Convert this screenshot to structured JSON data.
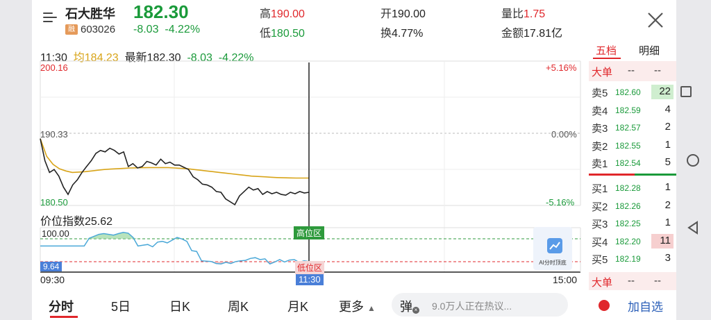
{
  "stock": {
    "name": "石大胜华",
    "code": "603026",
    "rong_badge": "融",
    "price": "182.30",
    "change": "-8.03",
    "change_pct": "-4.22%"
  },
  "header_stats": {
    "high_label": "高",
    "high_value": "190.00",
    "low_label": "低",
    "low_value": "180.50",
    "open_label": "开",
    "open_value": "190.00",
    "turnover_label": "换",
    "turnover_value": "4.77%",
    "volratio_label": "量比",
    "volratio_value": "1.75",
    "amount_label": "金额",
    "amount_value": "17.81亿"
  },
  "chart_info": {
    "time": "11:30",
    "avg_label": "均",
    "avg_value": "184.23",
    "latest_label": "最新",
    "latest_value": "182.30",
    "change": "-8.03",
    "change_pct": "-4.22%"
  },
  "chart_data": {
    "type": "line",
    "y_max": "200.16",
    "y_mid": "190.33",
    "y_min": "180.50",
    "pct_top": "+5.16%",
    "pct_mid": "0.00%",
    "pct_bottom": "-5.16%",
    "ylim": [
      180.5,
      200.16
    ],
    "x_start": "09:30",
    "x_cursor": "11:30",
    "x_end": "15:00",
    "series": [
      {
        "values": [
          189.6,
          186.6,
          185.0,
          185.4,
          184.5,
          183.0,
          182.0,
          183.3,
          184.0,
          185.0,
          185.8,
          186.6,
          187.6,
          188.0,
          187.8,
          188.3,
          188.0,
          187.5,
          187.8,
          185.8,
          186.2,
          185.6,
          185.8,
          186.5,
          186.3,
          186.0,
          186.8,
          186.2,
          186.4,
          186.0,
          186.0,
          185.7,
          185.4,
          184.4,
          184.0,
          183.4,
          183.3,
          183.0,
          182.4,
          182.3,
          181.4,
          181.0,
          180.6,
          181.8,
          182.4,
          183.0,
          182.6,
          182.8,
          182.0,
          182.4,
          182.1,
          182.3,
          182.0,
          181.9,
          182.3,
          182.1,
          182.4,
          182.2,
          182.3
        ]
      },
      {
        "values": [
          189.6,
          187.2,
          186.1,
          185.5,
          185.2,
          185.0,
          185.05,
          185.1,
          185.2,
          185.3,
          185.4,
          185.45,
          185.5,
          185.55,
          185.6,
          185.62,
          185.64,
          185.66,
          185.66,
          185.66,
          185.66,
          185.6,
          185.55,
          185.5,
          185.4,
          185.3,
          185.2,
          185.1,
          185.0,
          184.9,
          184.8,
          184.7,
          184.6,
          184.5,
          184.45,
          184.4,
          184.35,
          184.3,
          184.27,
          184.25,
          184.23,
          184.23,
          184.23
        ]
      }
    ]
  },
  "indicator": {
    "title": "价位指数25.62",
    "top_value": "100.00",
    "current_value": "9.64",
    "high_zone": "高位区",
    "low_zone": "低位区",
    "values": [
      60,
      60,
      60,
      60,
      60,
      60,
      60,
      60,
      60,
      60,
      80,
      85,
      90,
      92,
      90,
      88,
      92,
      95,
      93,
      82,
      60,
      62,
      64,
      58,
      70,
      72,
      68,
      75,
      82,
      78,
      72,
      48,
      46,
      22,
      21,
      20,
      15,
      14,
      18,
      15,
      20,
      22,
      23,
      28,
      30,
      25,
      27,
      14,
      19,
      25,
      19,
      24,
      25,
      18,
      22,
      20
    ]
  },
  "ai_widget": {
    "label": "AI分时顶底"
  },
  "order_book": {
    "tab_active": "五档",
    "tab_other": "明细",
    "big_label": "大单",
    "big_dash1": "--",
    "big_dash2": "--",
    "asks": [
      {
        "label": "卖5",
        "price": "182.60",
        "vol": "22",
        "bar": 1.0
      },
      {
        "label": "卖4",
        "price": "182.59",
        "vol": "4",
        "bar": 0
      },
      {
        "label": "卖3",
        "price": "182.57",
        "vol": "2",
        "bar": 0
      },
      {
        "label": "卖2",
        "price": "182.55",
        "vol": "1",
        "bar": 0
      },
      {
        "label": "卖1",
        "price": "182.54",
        "vol": "5",
        "bar": 0
      }
    ],
    "bids": [
      {
        "label": "买1",
        "price": "182.28",
        "vol": "1",
        "bar": 0
      },
      {
        "label": "买2",
        "price": "182.26",
        "vol": "2",
        "bar": 0
      },
      {
        "label": "买3",
        "price": "182.25",
        "vol": "1",
        "bar": 0
      },
      {
        "label": "买4",
        "price": "182.20",
        "vol": "11",
        "bar": 1.0
      },
      {
        "label": "买5",
        "price": "182.19",
        "vol": "3",
        "bar": 0
      }
    ],
    "big_label2": "大单",
    "big_dash3": "--",
    "big_dash4": "--"
  },
  "bottom_nav": {
    "tabs": [
      "分时",
      "5日",
      "日K",
      "周K",
      "月K"
    ],
    "more": "更多",
    "danmu": "弹",
    "hot_text": "9.0万人正在热议...",
    "add_watch": "加自选"
  },
  "colors": {
    "up": "#e0272b",
    "down": "#1a9a3a",
    "avg": "#d8a418",
    "price_line": "#222222",
    "indicator": "#4aa8d8"
  }
}
